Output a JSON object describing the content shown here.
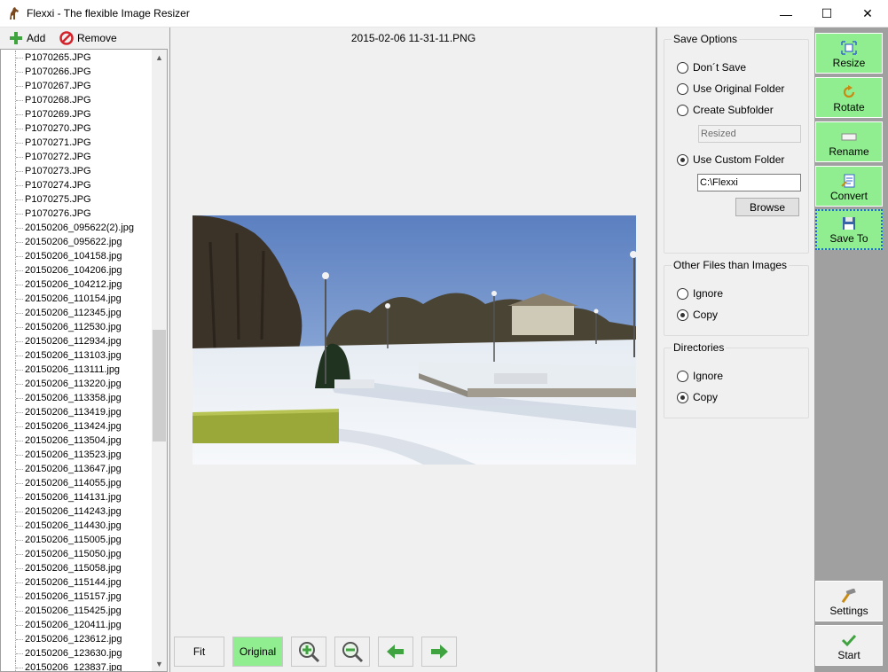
{
  "window": {
    "title": "Flexxi - The flexible Image Resizer",
    "minimize_glyph": "—",
    "maximize_glyph": "☐",
    "close_glyph": "✕"
  },
  "toolbar": {
    "add_label": "Add",
    "remove_label": "Remove"
  },
  "files": [
    "P1070265.JPG",
    "P1070266.JPG",
    "P1070267.JPG",
    "P1070268.JPG",
    "P1070269.JPG",
    "P1070270.JPG",
    "P1070271.JPG",
    "P1070272.JPG",
    "P1070273.JPG",
    "P1070274.JPG",
    "P1070275.JPG",
    "P1070276.JPG",
    "20150206_095622(2).jpg",
    "20150206_095622.jpg",
    "20150206_104158.jpg",
    "20150206_104206.jpg",
    "20150206_104212.jpg",
    "20150206_110154.jpg",
    "20150206_112345.jpg",
    "20150206_112530.jpg",
    "20150206_112934.jpg",
    "20150206_113103.jpg",
    "20150206_113111.jpg",
    "20150206_113220.jpg",
    "20150206_113358.jpg",
    "20150206_113419.jpg",
    "20150206_113424.jpg",
    "20150206_113504.jpg",
    "20150206_113523.jpg",
    "20150206_113647.jpg",
    "20150206_114055.jpg",
    "20150206_114131.jpg",
    "20150206_114243.jpg",
    "20150206_114430.jpg",
    "20150206_115005.jpg",
    "20150206_115050.jpg",
    "20150206_115058.jpg",
    "20150206_115144.jpg",
    "20150206_115157.jpg",
    "20150206_115425.jpg",
    "20150206_120411.jpg",
    "20150206_123612.jpg",
    "20150206_123630.jpg",
    "20150206_123837.jpg"
  ],
  "preview": {
    "filename": "2015-02-06 11-31-11.PNG",
    "fit_label": "Fit",
    "original_label": "Original"
  },
  "save_options": {
    "title": "Save Options",
    "dont_save": "Don´t Save",
    "use_original": "Use Original Folder",
    "create_subfolder": "Create Subfolder",
    "subfolder_value": "Resized",
    "use_custom": "Use Custom Folder",
    "custom_value": "C:\\Flexxi",
    "browse_label": "Browse",
    "selected": "use_custom"
  },
  "other_files": {
    "title": "Other Files than Images",
    "ignore": "Ignore",
    "copy": "Copy",
    "selected": "copy"
  },
  "directories": {
    "title": "Directories",
    "ignore": "Ignore",
    "copy": "Copy",
    "selected": "copy"
  },
  "actions": {
    "resize": "Resize",
    "rotate": "Rotate",
    "rename": "Rename",
    "convert": "Convert",
    "save_to": "Save To",
    "settings": "Settings",
    "start": "Start"
  },
  "colors": {
    "active_green": "#90ee90",
    "panel_grey": "#a0a0a0",
    "focus_blue": "#1e6bd6"
  }
}
